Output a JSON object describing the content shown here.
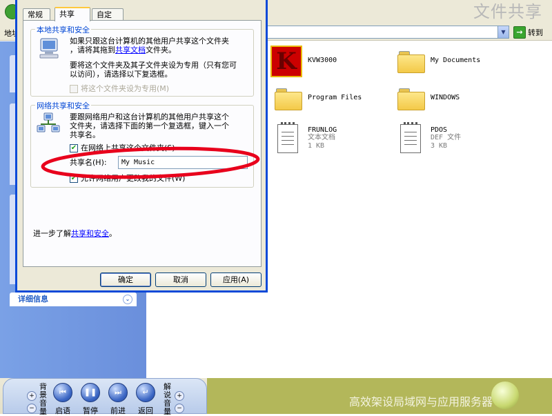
{
  "window": {
    "big_title": "文件共享",
    "address_label": "地址",
    "go_label": "转到"
  },
  "left_pane": {
    "details_label": "详细信息"
  },
  "files": [
    {
      "name": "KVW3000",
      "kind": "app"
    },
    {
      "name": "My Documents",
      "kind": "folder"
    },
    {
      "name": "Program Files",
      "kind": "folder"
    },
    {
      "name": "WINDOWS",
      "kind": "folder"
    },
    {
      "name": "FRUNLOG",
      "type": "文本文档",
      "size": "1 KB",
      "kind": "doc"
    },
    {
      "name": "PDOS",
      "type": "DEF 文件",
      "size": "3 KB",
      "kind": "doc"
    }
  ],
  "dialog": {
    "tabs": [
      "常规",
      "共享",
      "自定义"
    ],
    "active_tab": "共享",
    "local": {
      "title": "本地共享和安全",
      "line1": "如果只跟这台计算机的其他用户共享这个文件夹",
      "line2_pre": "，请将其拖到",
      "line2_link": "共享文档",
      "line2_post": "文件夹。",
      "line3": "要将这个文件夹及其子文件夹设为专用（只有您可",
      "line4": "以访问），请选择以下复选框。",
      "private_checkbox": "将这个文件夹设为专用(M)"
    },
    "network": {
      "title": "网络共享和安全",
      "line1": "要跟网络用户和这台计算机的其他用户共享这个",
      "line2": "文件夹，请选择下面的第一个复选框，键入一个",
      "line3": "共享名。",
      "share_checkbox": "在网络上共享这个文件夹(S)",
      "share_name_label": "共享名(H):",
      "share_name_value": "My Music",
      "allow_change_checkbox": "允许网络用户更改我的文件(W)"
    },
    "learn_more_pre": "进一步了解",
    "learn_more_link": "共享和安全",
    "learn_more_post": "。",
    "buttons": {
      "ok": "确定",
      "cancel": "取消",
      "apply": "应用(A)"
    }
  },
  "player": {
    "left_side": "背景音量",
    "right_side": "解说音量",
    "buttons": [
      "启语",
      "暂停",
      "前进",
      "返回"
    ],
    "course_title": "高效架设局域网与应用服务器"
  },
  "colors": {
    "xp_blue": "#0a49d8",
    "annotation_red": "#e8001c",
    "olive": "#b3b75a"
  }
}
